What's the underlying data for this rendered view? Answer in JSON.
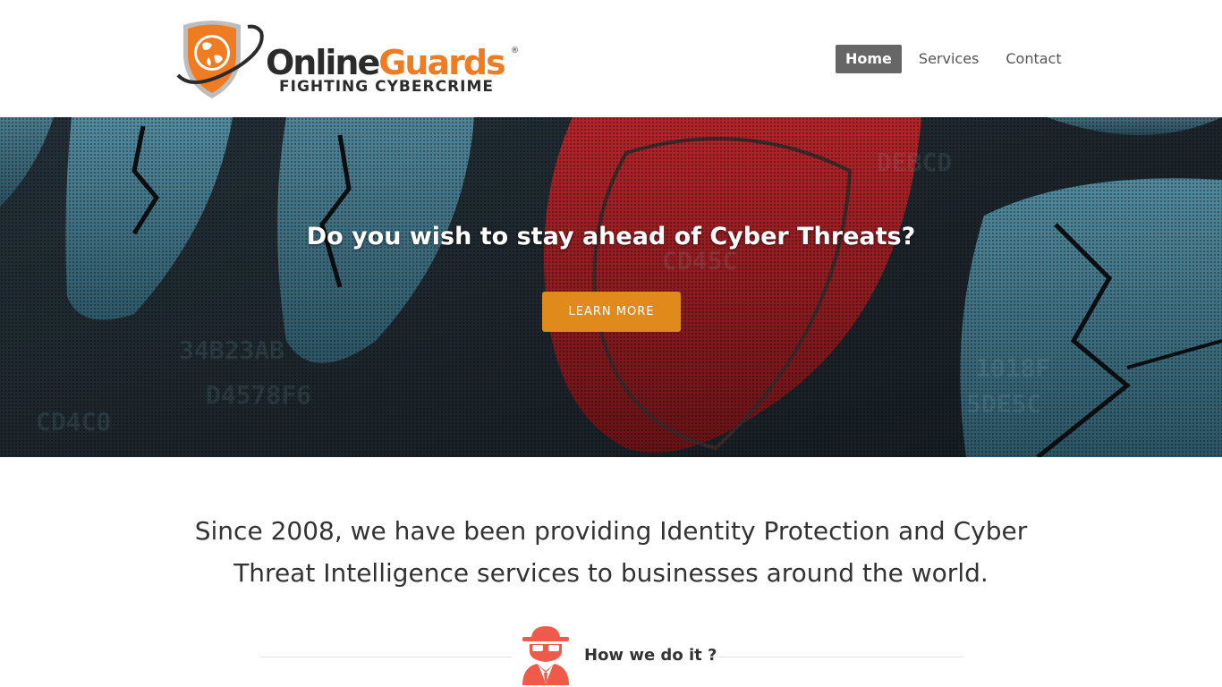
{
  "header": {
    "logo": {
      "name_part1": "Online",
      "name_part2": "Guards",
      "registered_mark": "®",
      "tagline": "FIGHTING CYBERCRIME",
      "icon": "shield-globe-icon"
    },
    "nav": [
      {
        "label": "Home",
        "active": true
      },
      {
        "label": "Services",
        "active": false
      },
      {
        "label": "Contact",
        "active": false
      }
    ]
  },
  "hero": {
    "title": "Do you wish to stay ahead of Cyber Threats?",
    "button_label": "LEARN MORE"
  },
  "intro": {
    "text": "Since 2008, we have been providing Identity Protection and Cyber Threat Intelligence services to businesses around the world."
  },
  "how": {
    "icon": "spy-icon",
    "label": "How we do it ?"
  },
  "colors": {
    "accent_orange": "#e08a1c",
    "brand_orange": "#f07c22",
    "nav_active_bg": "#666666",
    "spy_icon": "#f05a4a"
  }
}
